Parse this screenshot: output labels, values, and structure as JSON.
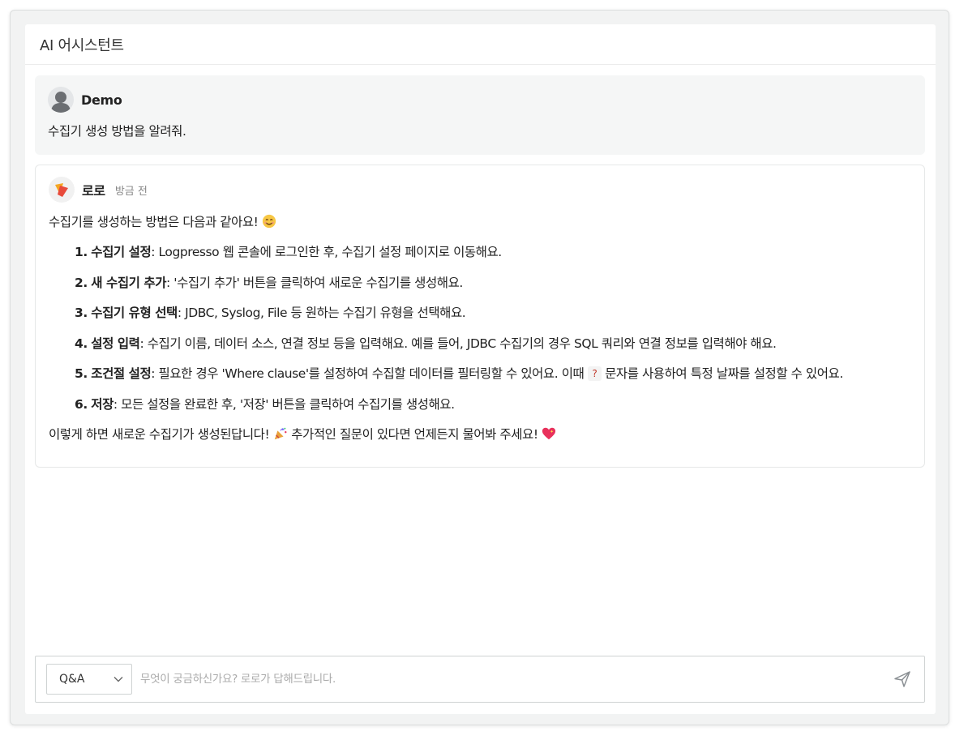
{
  "header": {
    "title": "AI 어시스턴트"
  },
  "user_message": {
    "author": "Demo",
    "text": "수집기 생성 방법을 알려줘."
  },
  "bot_message": {
    "author": "로로",
    "time": "방금 전",
    "intro": "수집기를 생성하는 방법은 다음과 같아요!",
    "steps": [
      {
        "num": "1.",
        "title": "수집기 설정",
        "text": ": Logpresso 웹 콘솔에 로그인한 후, 수집기 설정 페이지로 이동해요."
      },
      {
        "num": "2.",
        "title": "새 수집기 추가",
        "text": ": '수집기 추가' 버튼을 클릭하여 새로운 수집기를 생성해요."
      },
      {
        "num": "3.",
        "title": "수집기 유형 선택",
        "text": ": JDBC, Syslog, File 등 원하는 수집기 유형을 선택해요."
      },
      {
        "num": "4.",
        "title": "설정 입력",
        "text": ": 수집기 이름, 데이터 소스, 연결 정보 등을 입력해요. 예를 들어, JDBC 수집기의 경우 SQL 쿼리와 연결 정보를 입력해야 해요."
      },
      {
        "num": "5.",
        "title": "조건절 설정",
        "text": ": 필요한 경우 'Where clause'를 설정하여 수집할 데이터를 필터링할 수 있어요. 이때",
        "code": "?",
        "text_after": "문자를 사용하여 특정 날짜를 설정할 수 있어요."
      },
      {
        "num": "6.",
        "title": "저장",
        "text": ": 모든 설정을 완료한 후, '저장' 버튼을 클릭하여 수집기를 생성해요."
      }
    ],
    "outro_1": "이렇게 하면 새로운 수집기가 생성된답니다!",
    "outro_2": "추가적인 질문이 있다면 언제든지 물어봐 주세요!"
  },
  "input_bar": {
    "mode": "Q&A",
    "placeholder": "무엇이 궁금하신가요? 로로가 답해드립니다."
  },
  "icons": {
    "user_avatar": "user-silhouette-icon",
    "bot_avatar": "roro-logo-icon",
    "smile": "smiling-face-icon",
    "party": "party-popper-icon",
    "heart": "sparkling-heart-icon",
    "chevron": "chevron-down-icon",
    "send": "send-icon"
  },
  "colors": {
    "code_text": "#c0392b",
    "bot_logo_orange": "#f5a623",
    "bot_logo_red": "#e84a3b",
    "heart": "#e8315b"
  }
}
